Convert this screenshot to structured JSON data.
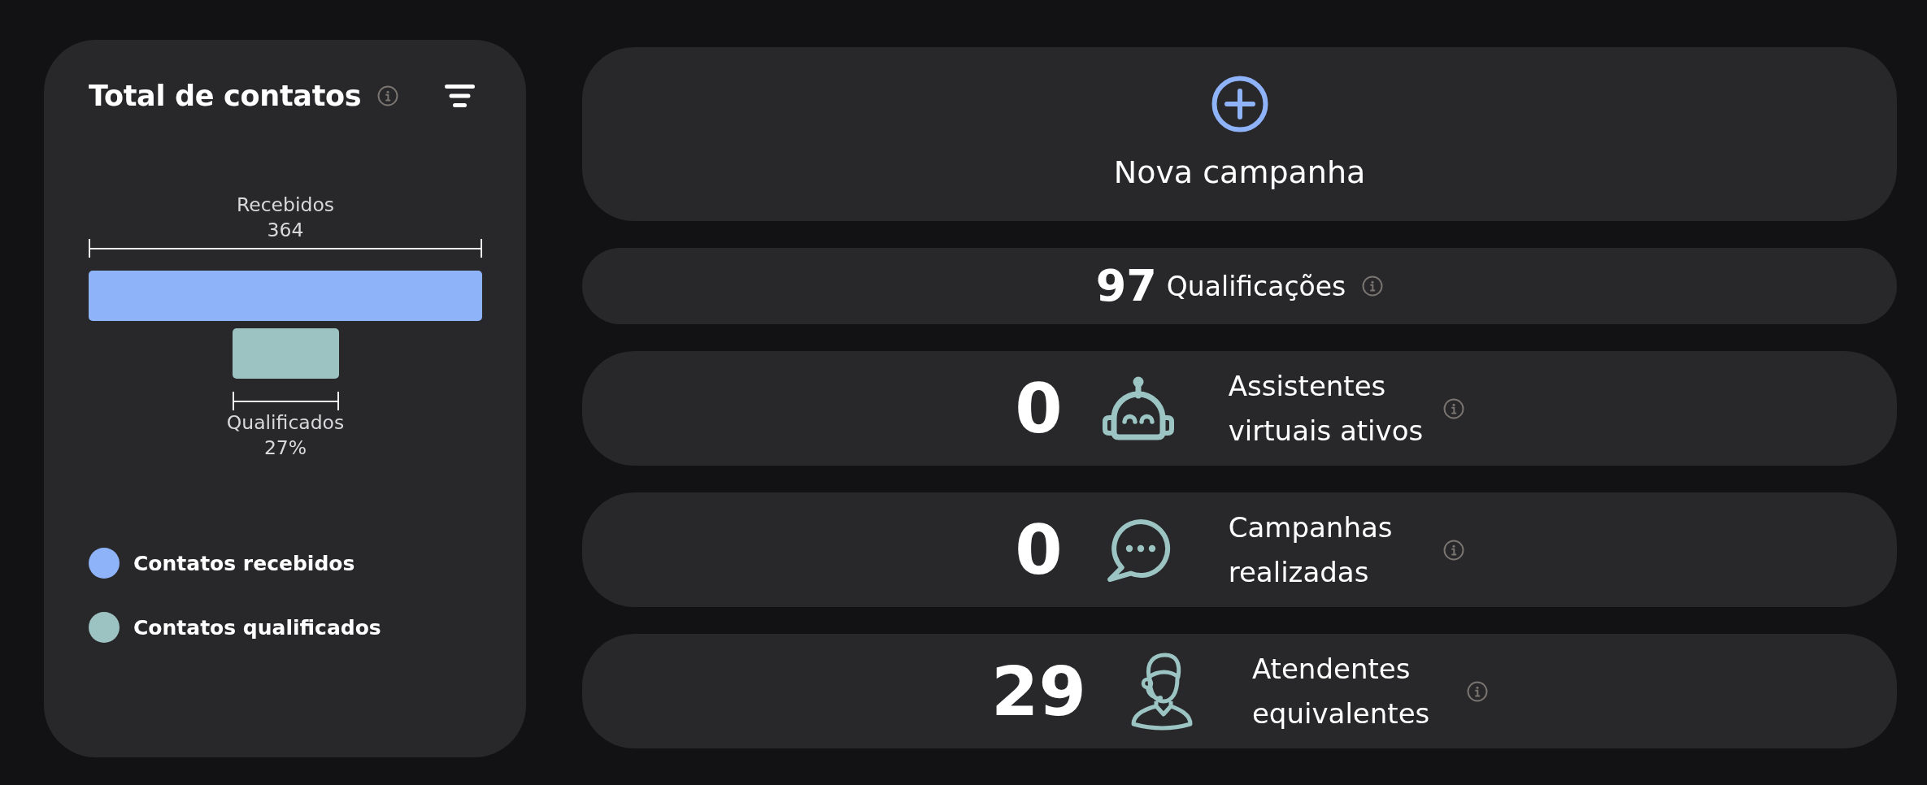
{
  "summary_card": {
    "title": "Total de contatos",
    "funnel": {
      "stages": [
        {
          "label": "Recebidos",
          "value": "364",
          "color": "#8fb3f9"
        },
        {
          "label": "Qualificados",
          "value": "27%",
          "color": "#9cc3c2"
        }
      ]
    },
    "legend": [
      {
        "label": "Contatos recebidos",
        "color": "#8fb3f9"
      },
      {
        "label": "Contatos qualificados",
        "color": "#9cc3c2"
      }
    ]
  },
  "new_campaign": {
    "label": "Nova campanha"
  },
  "qualifications": {
    "value": "97",
    "label": "Qualificações"
  },
  "stats": [
    {
      "kind": "robot",
      "value": "0",
      "label": "Assistentes virtuais ativos"
    },
    {
      "kind": "chat",
      "value": "0",
      "label": "Campanhas realizadas"
    },
    {
      "kind": "agent",
      "value": "29",
      "label": "Atendentes equivalentes"
    }
  ]
}
